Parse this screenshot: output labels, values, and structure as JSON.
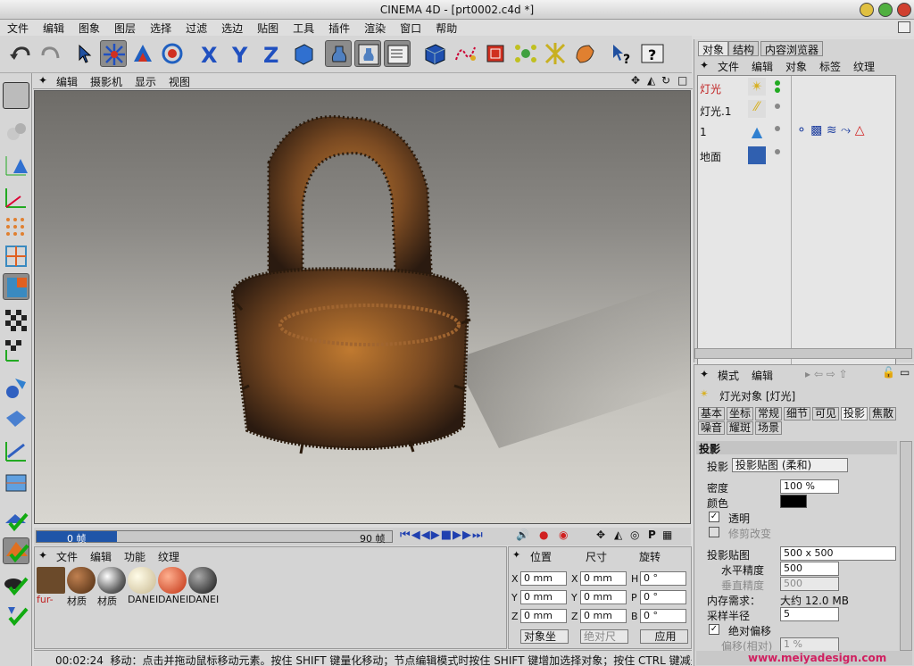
{
  "window": {
    "title": "CINEMA 4D - [prt0002.c4d *]"
  },
  "menubar": [
    "文件",
    "编辑",
    "图象",
    "图层",
    "选择",
    "过滤",
    "选边",
    "贴图",
    "工具",
    "插件",
    "渲染",
    "窗口",
    "帮助"
  ],
  "toolbar_icons": [
    "undo-icon",
    "redo-icon",
    "pointer-icon",
    "move-icon",
    "scale-icon",
    "rotate-icon",
    "x-axis-icon",
    "y-axis-icon",
    "z-axis-icon",
    "world-coords-icon",
    "render-view-icon",
    "render-picture-icon",
    "render-settings-icon",
    "cube-primitive-icon",
    "spline-icon",
    "nurbs-icon",
    "array-icon",
    "deformer-icon",
    "scene-icon",
    "help-cursor-icon",
    "help-icon"
  ],
  "viewport": {
    "menu": [
      "编辑",
      "摄影机",
      "显示",
      "视图"
    ]
  },
  "timeline": {
    "current": "0 帧",
    "end": "90 帧"
  },
  "material_manager": {
    "menu": [
      "文件",
      "编辑",
      "功能",
      "纹理"
    ],
    "materials": [
      {
        "label": "fur-",
        "color": "#6b4a2a"
      },
      {
        "label": "材质",
        "color": "#6b3a1c"
      },
      {
        "label": "材质",
        "color": "#8a8a8a"
      },
      {
        "label": "DANEI",
        "color": "#e8e0c0"
      },
      {
        "label": "DANEI",
        "color": "#d04020"
      },
      {
        "label": "DANEI",
        "color": "#303030"
      }
    ]
  },
  "coordinates": {
    "headers": [
      "位置",
      "尺寸",
      "旋转"
    ],
    "pos": [
      {
        "axis": "X",
        "value": "0 mm"
      },
      {
        "axis": "Y",
        "value": "0 mm"
      },
      {
        "axis": "Z",
        "value": "0 mm"
      }
    ],
    "size": [
      {
        "axis": "X",
        "value": "0 mm"
      },
      {
        "axis": "Y",
        "value": "0 mm"
      },
      {
        "axis": "Z",
        "value": "0 mm"
      }
    ],
    "rot": [
      {
        "axis": "H",
        "value": "0 °"
      },
      {
        "axis": "P",
        "value": "0 °"
      },
      {
        "axis": "B",
        "value": "0 °"
      }
    ],
    "mode1": "对象坐",
    "mode2": "绝对尺",
    "apply": "应用"
  },
  "statusbar": {
    "time": "00:02:24",
    "message": "移动：点击并拖动鼠标移动元素。按住 SHIFT 键量化移动；节点编辑模式时按住 SHIFT 键增加选择对象；按住 CTRL 键减少"
  },
  "object_manager": {
    "tabs": [
      "对象",
      "结构",
      "内容浏览器"
    ],
    "menu": [
      "文件",
      "编辑",
      "对象",
      "标签",
      "纹理"
    ],
    "objects": [
      {
        "name": "灯光",
        "selected": true
      },
      {
        "name": "灯光.1",
        "selected": false
      },
      {
        "name": "1",
        "selected": false
      },
      {
        "name": "地面",
        "selected": false
      }
    ]
  },
  "attribute_manager": {
    "menu": [
      "模式",
      "编辑"
    ],
    "object_title": "灯光对象 [灯光]",
    "tabs_row1": [
      "基本",
      "坐标",
      "常规",
      "细节",
      "可见",
      "投影",
      "焦散"
    ],
    "tabs_row2": [
      "噪音",
      "耀斑",
      "场景"
    ],
    "section": "投影",
    "shadow_label": "投影",
    "shadow_value": "投影贴图 (柔和)",
    "density_label": "密度",
    "density_value": "100 %",
    "color_label": "颜色",
    "transparency_label": "透明",
    "clip_label": "修剪改变",
    "shadowmap_label": "投影贴图",
    "shadowmap_value": "500 x 500",
    "hres_label": "水平精度",
    "hres_value": "500",
    "vres_label": "垂直精度",
    "vres_value": "500",
    "memory_label": "内存需求：",
    "memory_value": "大约 12.0 MB",
    "radius_label": "采样半径",
    "radius_value": "5",
    "abs_bias_label": "绝对偏移",
    "bias_label": "偏移(相对)",
    "bias_value": "1 %"
  },
  "watermark": "www.meiyadesign.com"
}
